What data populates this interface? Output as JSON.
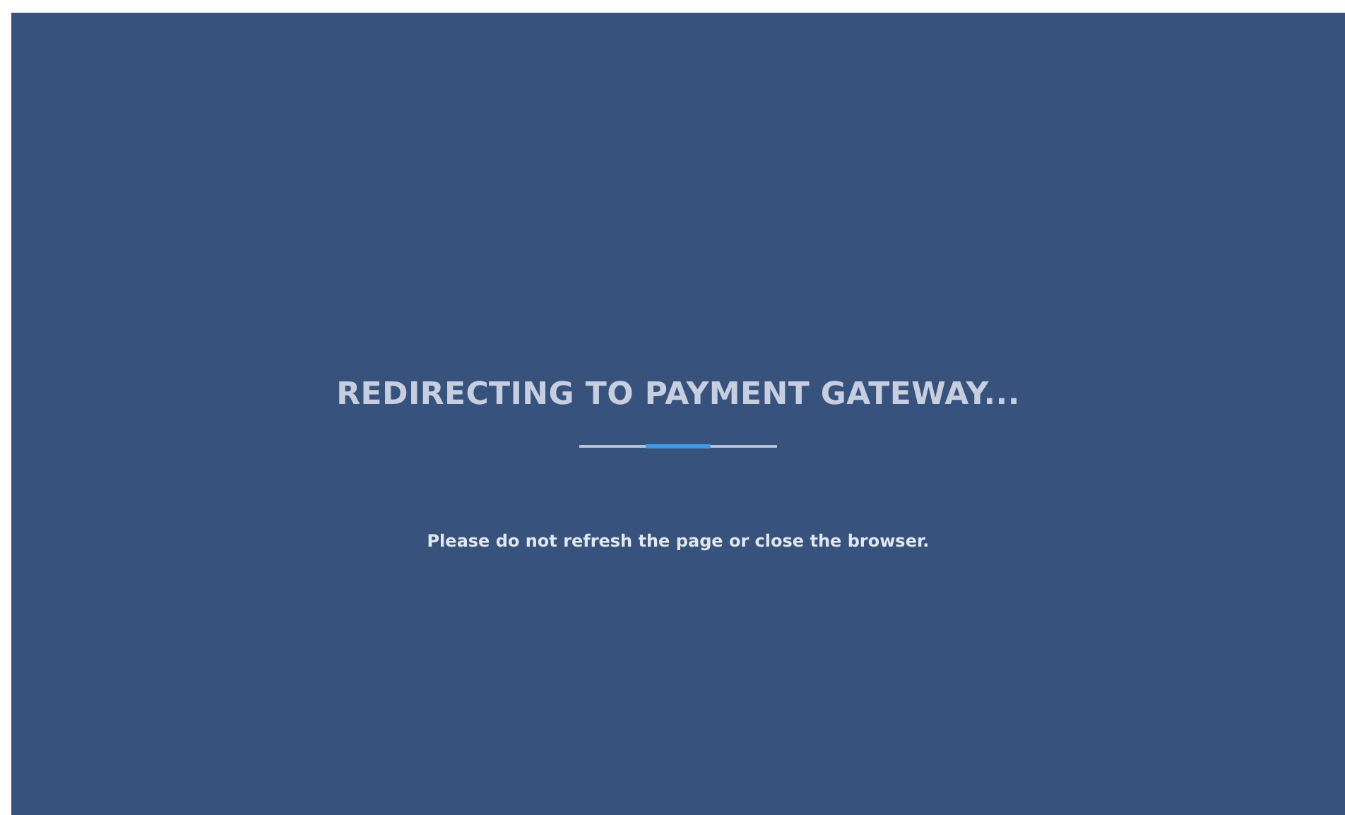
{
  "heading": "REDIRECTING TO PAYMENT GATEWAY...",
  "message": "Please do not refresh the page or close the browser."
}
